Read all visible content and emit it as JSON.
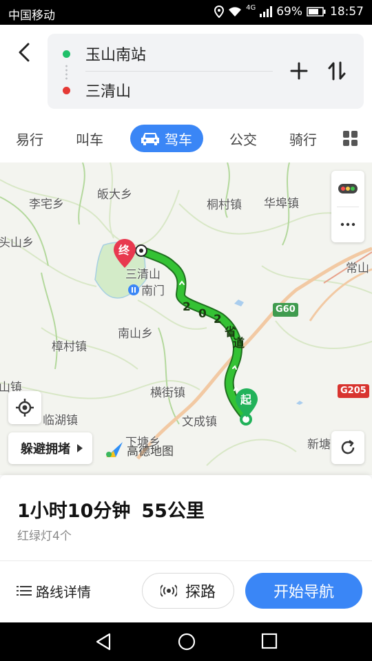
{
  "status_bar": {
    "carrier": "中国移动",
    "network": "4G",
    "battery": "69%",
    "time": "18:57"
  },
  "route": {
    "from": "玉山南站",
    "to": "三清山"
  },
  "tabs": [
    {
      "label": "易行"
    },
    {
      "label": "叫车"
    },
    {
      "label": "驾车",
      "active": true
    },
    {
      "label": "公交"
    },
    {
      "label": "骑行"
    }
  ],
  "map": {
    "places": {
      "lizhai": "李宅乡",
      "fangda": "皈大乡",
      "tongcun": "桐村镇",
      "huafu": "华埠镇",
      "toushan": "头山乡",
      "changshan": "常山",
      "sanqingshan": "三清山",
      "nanmen": "南门",
      "nanshan": "南山乡",
      "zhangcun": "樟村镇",
      "hengjie": "横街镇",
      "shan": "山镇",
      "linhu": "临湖镇",
      "wencheng": "文成镇",
      "xiatang": "下塘乡",
      "xindu": "新塘"
    },
    "highways": {
      "g60": "G60",
      "g205": "G205"
    },
    "road_label_chars": [
      "2",
      "0",
      "2",
      "省",
      "道"
    ],
    "marker_end": "终",
    "marker_start": "起",
    "avoid_label": "躲避拥堵",
    "brand": "高德地图"
  },
  "summary": {
    "duration": "1小时10分钟",
    "distance": "55公里",
    "traffic_lights": "红绿灯4个"
  },
  "actions": {
    "detail": "路线详情",
    "explore": "探路",
    "navigate": "开始导航"
  },
  "colors": {
    "accent": "#3a86f6",
    "route": "#2fb52f",
    "start_dot": "#20c06a",
    "end_dot": "#e53935"
  }
}
